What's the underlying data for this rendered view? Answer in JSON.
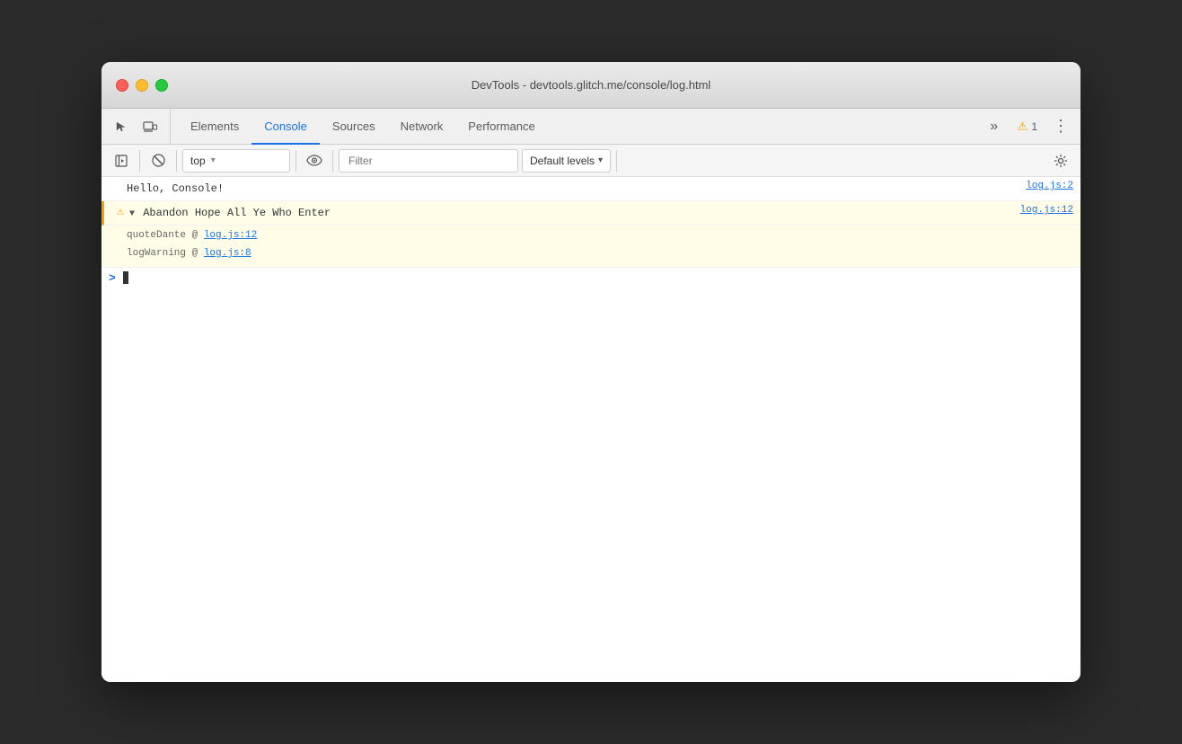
{
  "window": {
    "title": "DevTools - devtools.glitch.me/console/log.html",
    "traffic_lights": {
      "close_label": "close",
      "minimize_label": "minimize",
      "maximize_label": "maximize"
    }
  },
  "tabs": {
    "items": [
      {
        "id": "elements",
        "label": "Elements",
        "active": false
      },
      {
        "id": "console",
        "label": "Console",
        "active": true
      },
      {
        "id": "sources",
        "label": "Sources",
        "active": false
      },
      {
        "id": "network",
        "label": "Network",
        "active": false
      },
      {
        "id": "performance",
        "label": "Performance",
        "active": false
      }
    ],
    "more_label": "»",
    "warning_count": "1",
    "menu_label": "⋮"
  },
  "console_toolbar": {
    "sidebar_icon": "▶",
    "clear_icon": "🚫",
    "context_value": "top",
    "context_arrow": "▾",
    "filter_placeholder": "Filter",
    "levels_label": "Default levels",
    "levels_arrow": "▾",
    "settings_icon": "⚙"
  },
  "console_entries": [
    {
      "id": "entry1",
      "type": "info",
      "message": "Hello, Console!",
      "source": "log.js:2",
      "has_stack": false
    },
    {
      "id": "entry2",
      "type": "warning",
      "message": "▼ Abandon Hope All Ye Who Enter",
      "source": "log.js:12",
      "has_stack": true,
      "stack": [
        {
          "text": "quoteDante @ ",
          "link": "log.js:12"
        },
        {
          "text": "logWarning @ ",
          "link": "log.js:8"
        }
      ]
    }
  ],
  "console_input": {
    "prompt": ">"
  }
}
